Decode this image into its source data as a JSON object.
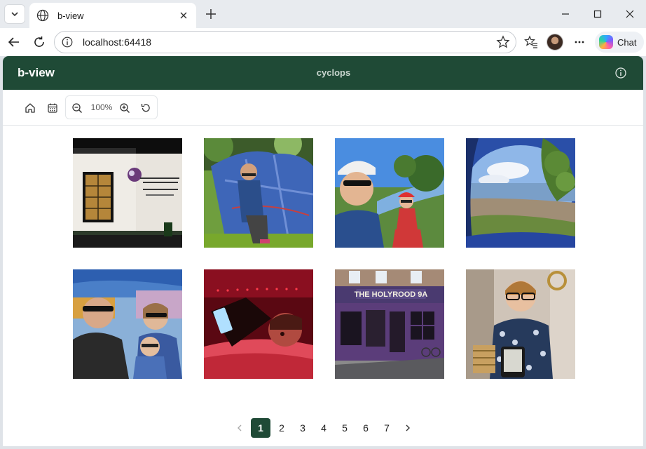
{
  "browser": {
    "tab_title": "b-view",
    "url": "localhost:64418",
    "copilot_label": "Chat"
  },
  "app": {
    "brand": "b-view",
    "center_title": "cyclops"
  },
  "toolbar": {
    "zoom_level": "100%"
  },
  "gallery": {
    "thumbnails": [
      {
        "subject": "pub corner building sign"
      },
      {
        "subject": "boy kneeling by blue tent"
      },
      {
        "subject": "cyclists selfie by river"
      },
      {
        "subject": "loch view from tent"
      },
      {
        "subject": "family selfie at mini golf"
      },
      {
        "subject": "child in red light"
      },
      {
        "subject": "purple pub facade"
      },
      {
        "subject": "boy holding e-reader"
      }
    ]
  },
  "pagination": {
    "current": "1",
    "pages": [
      "1",
      "2",
      "3",
      "4",
      "5",
      "6",
      "7"
    ],
    "prev_icon": "chevron-left-icon",
    "next_icon": "chevron-right-icon"
  },
  "colors": {
    "appbar": "#1f4a36",
    "active_page": "#1f4a36"
  }
}
